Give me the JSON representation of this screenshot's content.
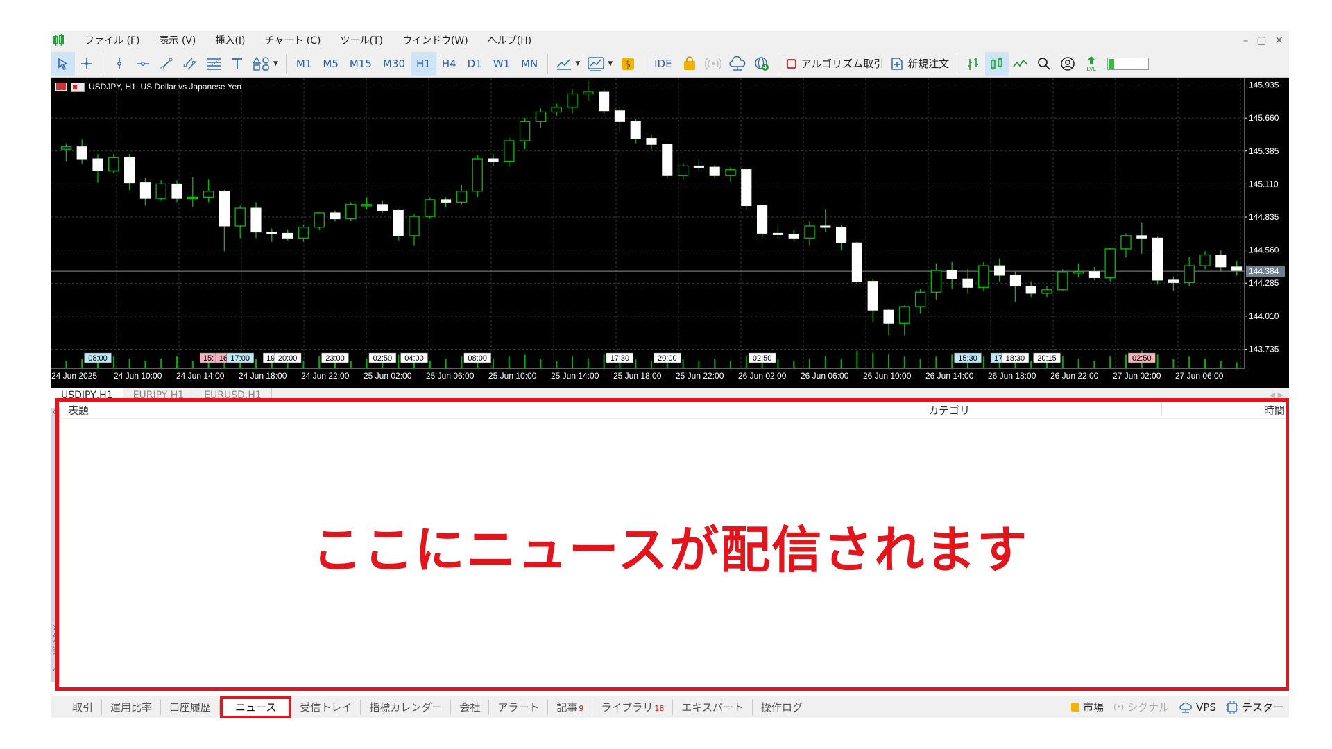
{
  "menu": {
    "items": [
      "ファイル (F)",
      "表示 (V)",
      "挿入(I)",
      "チャート (C)",
      "ツール(T)",
      "ウインドウ(W)",
      "ヘルプ(H)"
    ],
    "window_controls": [
      "–",
      "▢",
      "✕"
    ]
  },
  "toolbar": {
    "timeframes": [
      "M1",
      "M5",
      "M15",
      "M30",
      "H1",
      "H4",
      "D1",
      "W1",
      "MN"
    ],
    "active_timeframe": "H1",
    "ide_label": "IDE",
    "algo_label": "アルゴリズム取引",
    "new_order_label": "新規注文",
    "lvl_label": "LVL"
  },
  "chart": {
    "title": "USDJPY, H1:  US Dollar vs Japanese Yen",
    "price_ticks": [
      "145.935",
      "145.660",
      "145.385",
      "145.110",
      "144.835",
      "144.560",
      "144.285",
      "144.010",
      "143.735"
    ],
    "current_price": "144.384",
    "date_ticks": [
      "24 Jun 2025",
      "24 Jun 10:00",
      "24 Jun 14:00",
      "24 Jun 18:00",
      "24 Jun 22:00",
      "25 Jun 02:00",
      "25 Jun 06:00",
      "25 Jun 10:00",
      "25 Jun 14:00",
      "25 Jun 18:00",
      "25 Jun 22:00",
      "26 Jun 02:00",
      "26 Jun 06:00",
      "26 Jun 10:00",
      "26 Jun 14:00",
      "26 Jun 18:00",
      "26 Jun 22:00",
      "27 Jun 02:00",
      "27 Jun 06:00"
    ],
    "event_labels": [
      {
        "text": "08:00",
        "color": "#bfe8f5",
        "slot": 2
      },
      {
        "text": "15:",
        "color": "#f5b5bf",
        "slot": 9
      },
      {
        "text": "16:",
        "color": "#f5b5bf",
        "slot": 10
      },
      {
        "text": "17:00",
        "color": "#bfe8f5",
        "slot": 11
      },
      {
        "text": "19:",
        "color": "#ffffff",
        "slot": 13
      },
      {
        "text": "20:00",
        "color": "#ffffff",
        "slot": 14
      },
      {
        "text": "23:00",
        "color": "#ffffff",
        "slot": 17
      },
      {
        "text": "02:50",
        "color": "#ffffff",
        "slot": 20
      },
      {
        "text": "04:00",
        "color": "#ffffff",
        "slot": 22
      },
      {
        "text": "08:00",
        "color": "#ffffff",
        "slot": 26
      },
      {
        "text": "17:30",
        "color": "#ffffff",
        "slot": 35
      },
      {
        "text": "20:00",
        "color": "#ffffff",
        "slot": 38
      },
      {
        "text": "02:50",
        "color": "#ffffff",
        "slot": 44
      },
      {
        "text": "15:30",
        "color": "#bfe8f5",
        "slot": 57
      },
      {
        "text": "17:",
        "color": "#bfe8f5",
        "slot": 59
      },
      {
        "text": "18:30",
        "color": "#ffffff",
        "slot": 60
      },
      {
        "text": "20:15",
        "color": "#ffffff",
        "slot": 62
      },
      {
        "text": "02:50",
        "color": "#f5b5bf",
        "slot": 68
      }
    ],
    "candles": [
      [
        145.4,
        145.42,
        145.3,
        145.45
      ],
      [
        145.42,
        145.32,
        145.28,
        145.48
      ],
      [
        145.32,
        145.22,
        145.12,
        145.36
      ],
      [
        145.22,
        145.33,
        145.2,
        145.36
      ],
      [
        145.33,
        145.12,
        145.06,
        145.36
      ],
      [
        145.12,
        144.99,
        144.93,
        145.16
      ],
      [
        144.99,
        145.11,
        144.97,
        145.14
      ],
      [
        145.11,
        144.99,
        144.96,
        145.14
      ],
      [
        144.99,
        145.0,
        144.92,
        145.17
      ],
      [
        145.0,
        145.05,
        144.96,
        145.15
      ],
      [
        145.05,
        144.76,
        144.55,
        145.06
      ],
      [
        144.76,
        144.91,
        144.66,
        144.93
      ],
      [
        144.91,
        144.71,
        144.66,
        144.96
      ],
      [
        144.71,
        144.7,
        144.63,
        144.74
      ],
      [
        144.7,
        144.66,
        144.64,
        144.73
      ],
      [
        144.66,
        144.75,
        144.63,
        144.77
      ],
      [
        144.75,
        144.87,
        144.73,
        144.88
      ],
      [
        144.87,
        144.82,
        144.8,
        144.89
      ],
      [
        144.82,
        144.94,
        144.8,
        144.96
      ],
      [
        144.94,
        144.94,
        144.9,
        145.0
      ],
      [
        144.94,
        144.89,
        144.87,
        144.97
      ],
      [
        144.89,
        144.68,
        144.64,
        144.9
      ],
      [
        144.68,
        144.84,
        144.6,
        144.86
      ],
      [
        144.84,
        144.98,
        144.82,
        145.0
      ],
      [
        144.98,
        144.96,
        144.92,
        145.0
      ],
      [
        144.96,
        145.05,
        144.94,
        145.1
      ],
      [
        145.05,
        145.32,
        145.0,
        145.35
      ],
      [
        145.32,
        145.3,
        145.26,
        145.36
      ],
      [
        145.3,
        145.47,
        145.25,
        145.5
      ],
      [
        145.47,
        145.63,
        145.4,
        145.66
      ],
      [
        145.63,
        145.71,
        145.58,
        145.74
      ],
      [
        145.71,
        145.75,
        145.68,
        145.78
      ],
      [
        145.75,
        145.86,
        145.7,
        145.9
      ],
      [
        145.86,
        145.88,
        145.8,
        145.97
      ],
      [
        145.88,
        145.72,
        145.7,
        145.9
      ],
      [
        145.72,
        145.63,
        145.55,
        145.75
      ],
      [
        145.63,
        145.49,
        145.45,
        145.65
      ],
      [
        145.49,
        145.44,
        145.4,
        145.52
      ],
      [
        145.44,
        145.18,
        145.16,
        145.45
      ],
      [
        145.18,
        145.26,
        145.15,
        145.28
      ],
      [
        145.26,
        145.25,
        145.22,
        145.32
      ],
      [
        145.25,
        145.18,
        145.16,
        145.27
      ],
      [
        145.18,
        145.23,
        145.13,
        145.25
      ],
      [
        145.23,
        144.93,
        144.9,
        145.24
      ],
      [
        144.93,
        144.7,
        144.67,
        144.94
      ],
      [
        144.7,
        144.69,
        144.66,
        144.76
      ],
      [
        144.69,
        144.66,
        144.64,
        144.73
      ],
      [
        144.66,
        144.76,
        144.6,
        144.8
      ],
      [
        144.76,
        144.75,
        144.71,
        144.9
      ],
      [
        144.75,
        144.62,
        144.56,
        144.77
      ],
      [
        144.62,
        144.3,
        144.28,
        144.64
      ],
      [
        144.3,
        144.06,
        143.96,
        144.32
      ],
      [
        144.06,
        143.95,
        143.85,
        144.07
      ],
      [
        143.95,
        144.09,
        143.85,
        144.1
      ],
      [
        144.09,
        144.21,
        144.03,
        144.24
      ],
      [
        144.21,
        144.39,
        144.15,
        144.45
      ],
      [
        144.39,
        144.32,
        144.24,
        144.46
      ],
      [
        144.32,
        144.25,
        144.2,
        144.4
      ],
      [
        144.25,
        144.43,
        144.22,
        144.46
      ],
      [
        144.43,
        144.35,
        144.3,
        144.49
      ],
      [
        144.35,
        144.26,
        144.13,
        144.38
      ],
      [
        144.26,
        144.2,
        144.17,
        144.3
      ],
      [
        144.2,
        144.23,
        144.17,
        144.26
      ],
      [
        144.23,
        144.38,
        144.22,
        144.4
      ],
      [
        144.38,
        144.38,
        144.33,
        144.45
      ],
      [
        144.38,
        144.33,
        144.31,
        144.42
      ],
      [
        144.33,
        144.57,
        144.3,
        144.58
      ],
      [
        144.57,
        144.68,
        144.5,
        144.7
      ],
      [
        144.68,
        144.66,
        144.53,
        144.79
      ],
      [
        144.66,
        144.31,
        144.28,
        144.67
      ],
      [
        144.31,
        144.29,
        144.22,
        144.34
      ],
      [
        144.29,
        144.43,
        144.26,
        144.5
      ],
      [
        144.43,
        144.52,
        144.4,
        144.55
      ],
      [
        144.52,
        144.42,
        144.38,
        144.56
      ],
      [
        144.42,
        144.39,
        144.35,
        144.47
      ]
    ],
    "volumes": [
      0.4,
      0.5,
      0.7,
      0.6,
      0.5,
      0.4,
      0.5,
      0.6,
      0.4,
      0.5,
      0.8,
      0.6,
      0.5,
      0.4,
      0.5,
      0.4,
      0.6,
      0.5,
      0.4,
      0.5,
      0.6,
      0.7,
      0.5,
      0.4,
      0.5,
      0.6,
      0.8,
      0.5,
      0.6,
      0.7,
      0.5,
      0.4,
      0.6,
      0.5,
      0.7,
      0.6,
      0.5,
      0.4,
      0.8,
      0.5,
      0.4,
      0.5,
      0.4,
      0.6,
      0.7,
      0.5,
      0.4,
      0.5,
      0.6,
      0.5,
      0.9,
      0.8,
      0.7,
      0.6,
      0.5,
      0.6,
      0.7,
      0.5,
      0.6,
      0.5,
      0.6,
      0.4,
      0.5,
      0.6,
      0.5,
      0.4,
      0.6,
      0.7,
      0.9,
      0.7,
      0.5,
      0.6,
      0.5,
      0.4,
      0.3
    ]
  },
  "chart_tabs": [
    "USDJPY,H1",
    "EURJPY,H1",
    "EURUSD,H1"
  ],
  "news": {
    "columns": {
      "title": "表題",
      "category": "カテゴリ",
      "time": "時間"
    },
    "callout": "ここにニュースが配信されます",
    "side_label": "ツールボックス"
  },
  "bottom_tabs": [
    {
      "label": "取引"
    },
    {
      "label": "運用比率"
    },
    {
      "label": "口座履歴"
    },
    {
      "label": "ニュース",
      "active": true
    },
    {
      "label": "受信トレイ"
    },
    {
      "label": "指標カレンダー"
    },
    {
      "label": "会社"
    },
    {
      "label": "アラート"
    },
    {
      "label": "記事",
      "badge": "9"
    },
    {
      "label": "ライブラリ",
      "badge": "18"
    },
    {
      "label": "エキスパート"
    },
    {
      "label": "操作ログ"
    }
  ],
  "status": {
    "market": "市場",
    "signals": "シグナル",
    "vps": "VPS",
    "tester": "テスター"
  },
  "colors": {
    "accent_red": "#e3141c",
    "bull_candle": "#ffffff",
    "bear_candle": "#ffffff",
    "wick": "#00c000",
    "toolbar_icon": "#2d6bb5"
  }
}
